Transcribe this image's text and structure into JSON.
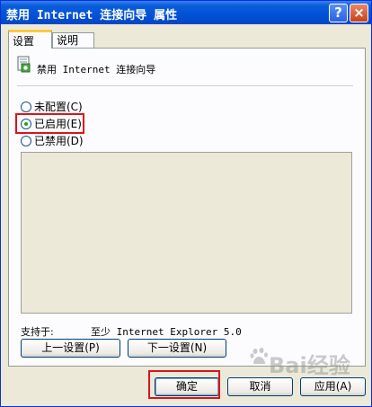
{
  "window": {
    "title": "禁用 Internet 连接向导 属性",
    "help_label": "?",
    "close_label": "×"
  },
  "tabs": [
    {
      "label": "设置",
      "active": true
    },
    {
      "label": "说明",
      "active": false
    }
  ],
  "policy": {
    "icon": "policy-settings-icon",
    "title": "禁用 Internet 连接向导"
  },
  "options": [
    {
      "label": "未配置(C)",
      "selected": false
    },
    {
      "label": "已启用(E)",
      "selected": true
    },
    {
      "label": "已禁用(D)",
      "selected": false
    }
  ],
  "support": {
    "label": "支持于:",
    "value": "至少 Internet Explorer 5.0"
  },
  "nav_buttons": {
    "prev": "上一设置(P)",
    "next": "下一设置(N)"
  },
  "dialog_buttons": {
    "ok": "确定",
    "cancel": "取消",
    "apply": "应用(A)"
  },
  "watermark": {
    "text": "Bai经验",
    "logo": "baidu-paw-icon"
  },
  "colors": {
    "titlebar": "#0052d6",
    "highlight": "#d9141b",
    "face": "#ece9d8"
  }
}
